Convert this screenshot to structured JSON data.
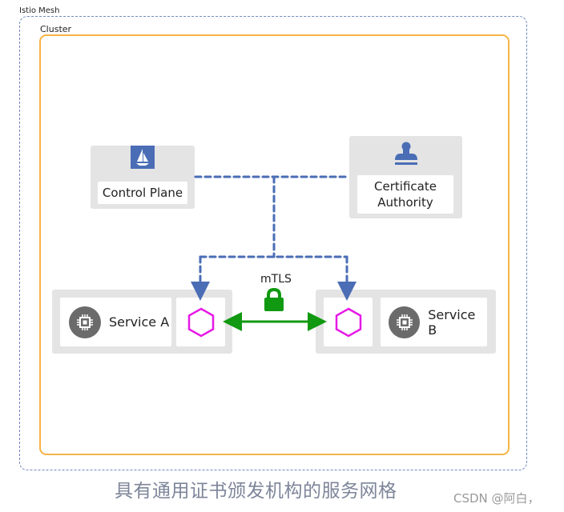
{
  "mesh": {
    "label": "Istio Mesh"
  },
  "cluster": {
    "label": "Cluster"
  },
  "control_plane": {
    "label": "Control Plane",
    "icon": "istio-sailboat-icon"
  },
  "certificate_authority": {
    "label_line1": "Certificate",
    "label_line2": "Authority",
    "icon": "stamp-icon"
  },
  "service_a": {
    "label": "Service A",
    "icon": "chip-icon",
    "proxy_icon": "hexagon-icon"
  },
  "service_b": {
    "label": "Service B",
    "icon": "chip-icon",
    "proxy_icon": "hexagon-icon"
  },
  "connection": {
    "label": "mTLS",
    "icon": "lock-icon"
  },
  "caption": {
    "title": "具有通用证书颁发机构的服务网格",
    "watermark": "CSDN @阿白，"
  },
  "colors": {
    "mesh_border": "#6f88c2",
    "cluster_border": "#f7b446",
    "dashed_link": "#4a6db5",
    "mtls_arrow": "#119911",
    "proxy_hexagon": "#e619e6",
    "icon_blue": "#4a6db5",
    "chip_bg": "#6b6b6b"
  }
}
